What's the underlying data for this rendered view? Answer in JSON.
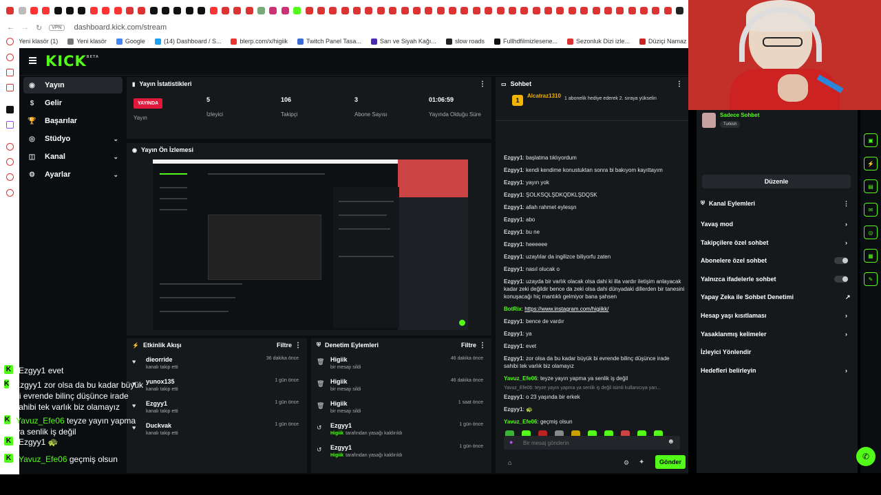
{
  "browser": {
    "url": "dashboard.kick.com/stream",
    "vpn": "VPN",
    "bookmarks": [
      "Yeni klasör (1)",
      "Yeni klasör",
      "Google",
      "(14) Dashboard / S...",
      "blerp.com/x/higiik",
      "Twitch Panel Tasa...",
      "Sarı ve Siyah Kağı...",
      "slow roads",
      "Fullhdfilmizlesene...",
      "Sezonluk Dizi izle...",
      "Düziçi Namaz Vak"
    ]
  },
  "nav": {
    "logo": "KICK",
    "logo_beta": "BETA",
    "items": [
      {
        "label": "Yayın",
        "icon": "target-icon",
        "active": true
      },
      {
        "label": "Gelir",
        "icon": "dollar-icon"
      },
      {
        "label": "Başarılar",
        "icon": "trophy-icon"
      },
      {
        "label": "Stüdyo",
        "icon": "studio-icon",
        "chevron": true
      },
      {
        "label": "Kanal",
        "icon": "channel-icon",
        "chevron": true
      },
      {
        "label": "Ayarlar",
        "icon": "gear-icon",
        "chevron": true
      }
    ]
  },
  "stats": {
    "title": "Yayın İstatistikleri",
    "live_badge": "YAYINDA",
    "live_label": "Yayın",
    "viewers": {
      "value": "5",
      "label": "İzleyici"
    },
    "followers": {
      "value": "106",
      "label": "Takipçi"
    },
    "subs": {
      "value": "3",
      "label": "Abone Sayısı"
    },
    "uptime": {
      "value": "01:06:59",
      "label": "Yayında Olduğu Süre"
    }
  },
  "preview": {
    "title": "Yayın Ön İzlemesi"
  },
  "activity": {
    "title": "Etkinlik Akışı",
    "filter": "Filtre",
    "items": [
      {
        "name": "dieorride",
        "sub": "kanalı takip etti",
        "time": "36 dakika önce"
      },
      {
        "name": "yunox135",
        "sub": "kanalı takip etti",
        "time": "1 gün önce"
      },
      {
        "name": "Ezgyy1",
        "sub": "kanalı takip etti",
        "time": "1 gün önce"
      },
      {
        "name": "Duckvak",
        "sub": "kanalı takip etti",
        "time": "1 gün önce"
      }
    ]
  },
  "moderation": {
    "title": "Denetim Eylemleri",
    "filter": "Filtre",
    "items": [
      {
        "name": "Higiik",
        "sub": "bir mesajı sildi",
        "time": "46 dakika önce",
        "icon": "trash-icon"
      },
      {
        "name": "Higiik",
        "sub": "bir mesajı sildi",
        "time": "46 dakika önce",
        "icon": "trash-icon"
      },
      {
        "name": "Higiik",
        "sub": "bir mesajı sildi",
        "time": "1 saat önce",
        "icon": "trash-icon"
      },
      {
        "name": "Ezgyy1",
        "sub_prefix": "Higiik",
        "sub": "tarafından yasağı kaldırıldı",
        "time": "1 gün önce",
        "icon": "undo-icon"
      },
      {
        "name": "Ezgyy1",
        "sub_prefix": "Higiik",
        "sub": "tarafından yasağı kaldırıldı",
        "time": "1 gün önce",
        "icon": "undo-icon"
      }
    ]
  },
  "chat": {
    "title": "Sohbet",
    "pinned_user": "Alcatraz1310",
    "pinned_text": "1 abonelik hediye ederek 2. sıraya yükselin",
    "messages": [
      {
        "user": "Ezgyy1",
        "text": "başlatma tıklıyordum"
      },
      {
        "user": "Ezgyy1",
        "text": "kendi kendime konustuktan sonra bi bakıyom kayıttayım"
      },
      {
        "user": "Ezgyy1",
        "text": "yayın yok"
      },
      {
        "user": "Ezgyy1",
        "text": "ŞOLKSQLŞDKQDKLŞDQSK"
      },
      {
        "user": "Ezgyy1",
        "text": "allah rahmet eylesşn"
      },
      {
        "user": "Ezgyy1",
        "text": "abo"
      },
      {
        "user": "Ezgyy1",
        "text": "bu ne"
      },
      {
        "user": "Ezgyy1",
        "text": "heeeeee"
      },
      {
        "user": "Ezgyy1",
        "text": "uzaylılar da ingilizce biliyorfu zaten"
      },
      {
        "user": "Ezgyy1",
        "text": "nasıl olucak o"
      },
      {
        "user": "Ezgyy1",
        "text": "uzayda bir varlık olacak olsa dahi ki illa vardır iletişim anlayacak kadar zeki değildir bence da zeki olsa dahi dünyadaki dillerden bir tanesini konuşacağı hiç mantıklı gelmiyor bana şahsen"
      },
      {
        "user": "BotRix",
        "text": "https://www.instagram.com/higiikk/",
        "link": true
      },
      {
        "user": "Ezgyy1",
        "text": "bence de vardır"
      },
      {
        "user": "Ezgyy1",
        "text": "ya"
      },
      {
        "user": "Ezgyy1",
        "text": "evet"
      },
      {
        "user": "Ezgyy1",
        "text": "zor olsa da bu kadar büyük bi evrende bilinç düşünce irade sahibi tek varlık biz olamayız"
      },
      {
        "user": "Yavuz_Efe06",
        "text": "teyze yayın yapma ya senlik iş değil"
      },
      {
        "user": "Ezgyy1",
        "text": "o 23 yaşında bir erkek",
        "reply": "Yavuz_Efe06: teyze yayın yapma ya senlik iş değil isimli kullanıcıya yan..."
      },
      {
        "user": "Ezgyy1",
        "text": "🐢"
      },
      {
        "user": "Yavuz_Efe06",
        "text": "geçmiş olsun"
      }
    ],
    "input_placeholder": "Bir mesaj gönderin",
    "send_label": "Gönder"
  },
  "side": {
    "chat_mode": "Sadece Sohbet",
    "language": "Turkish",
    "edit_label": "Düzenle",
    "actions_title": "Kanal Eylemleri",
    "actions": [
      {
        "label": "Yavaş mod",
        "arrow": true
      },
      {
        "label": "Takipçilere özel sohbet",
        "arrow": true
      },
      {
        "label": "Abonelere özel sohbet",
        "toggle": true
      },
      {
        "label": "Yalnızca ifadelerle sohbet",
        "toggle": true
      },
      {
        "label": "Yapay Zeka ile Sohbet Denetimi",
        "external": true
      },
      {
        "label": "Hesap yaşı kısıtlaması",
        "arrow": true
      },
      {
        "label": "Yasaklanmış kelimeler",
        "arrow": true
      },
      {
        "label": "İzleyici Yönlendir"
      },
      {
        "label": "Hedefleri belirleyin",
        "arrow": true
      }
    ]
  },
  "overlay": [
    {
      "user": "Ezgyy1",
      "text": "evet"
    },
    {
      "user": "Ezgyy1",
      "text": "zor olsa da bu kadar büyük bi evrende bilinç düşünce irade sahibi tek varlık biz olamayız"
    },
    {
      "user": "Yavuz_Efe06",
      "text": "teyze yayın yapma ya senlik iş değil"
    },
    {
      "user": "Ezgyy1",
      "text": "🐢"
    },
    {
      "user": "Yavuz_Efe06",
      "text": "geçmiş olsun"
    }
  ],
  "colors": {
    "accent": "#53fc18",
    "live": "#e0183a",
    "panel": "#16191c",
    "bg": "#0b0e10"
  }
}
